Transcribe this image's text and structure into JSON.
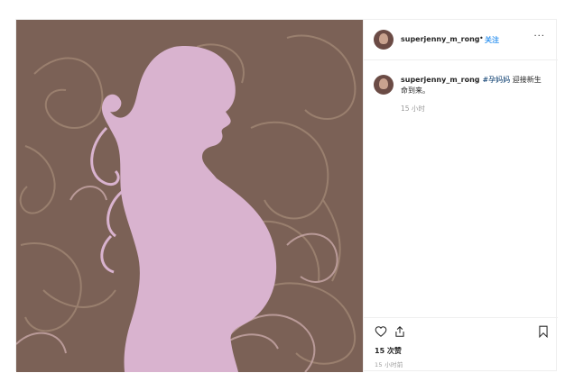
{
  "post": {
    "username": "superjenny_m_rong",
    "separator": "•",
    "follow_label": "关注",
    "more_label": "···",
    "caption": {
      "hashtag": "#孕妈妈",
      "text": " 迎接新生命到来。"
    },
    "caption_time": "15 小时",
    "likes": "15 次赞",
    "post_time": "15 小时前",
    "image_description_icon": "pregnant-silhouette-illustration"
  },
  "colors": {
    "image_bg": "#7b6156",
    "silhouette": "#d9b3cf",
    "follow": "#3897f0",
    "hashtag": "#003569"
  }
}
